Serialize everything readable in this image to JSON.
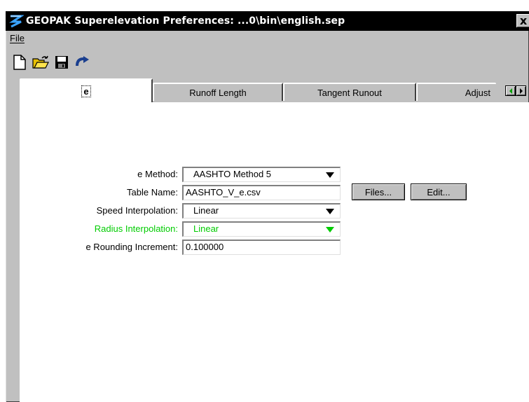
{
  "window": {
    "title": "GEOPAK Superelevation Preferences:  ...0\\bin\\english.sep",
    "close_label": "x"
  },
  "menu": [
    {
      "label": "File"
    }
  ],
  "toolbar": {
    "icons": [
      "new-file-icon",
      "open-folder-icon",
      "save-disk-icon",
      "redo-arrow-icon"
    ]
  },
  "tabs": [
    {
      "label": "e",
      "active": true
    },
    {
      "label": "Runoff Length",
      "active": false
    },
    {
      "label": "Tangent Runout",
      "active": false
    },
    {
      "label": "Adjust",
      "active": false
    }
  ],
  "form": {
    "e_method": {
      "label": "e Method:",
      "value": "AASHTO Method 5"
    },
    "table_name": {
      "label": "Table Name:",
      "value": "AASHTO_V_e.csv"
    },
    "files_button": "Files...",
    "edit_button": "Edit...",
    "speed_interpolation": {
      "label": "Speed Interpolation:",
      "value": "Linear"
    },
    "radius_interpolation": {
      "label": "Radius Interpolation:",
      "value": "Linear",
      "color": "#00cc00",
      "disabled": true
    },
    "e_rounding": {
      "label": "e Rounding Increment:",
      "value": "0.100000"
    }
  },
  "colors": {
    "titlebar": "#000000",
    "window_bg": "#c0c0c0",
    "panel_bg": "#ffffff",
    "disabled_text": "#00cc00"
  }
}
